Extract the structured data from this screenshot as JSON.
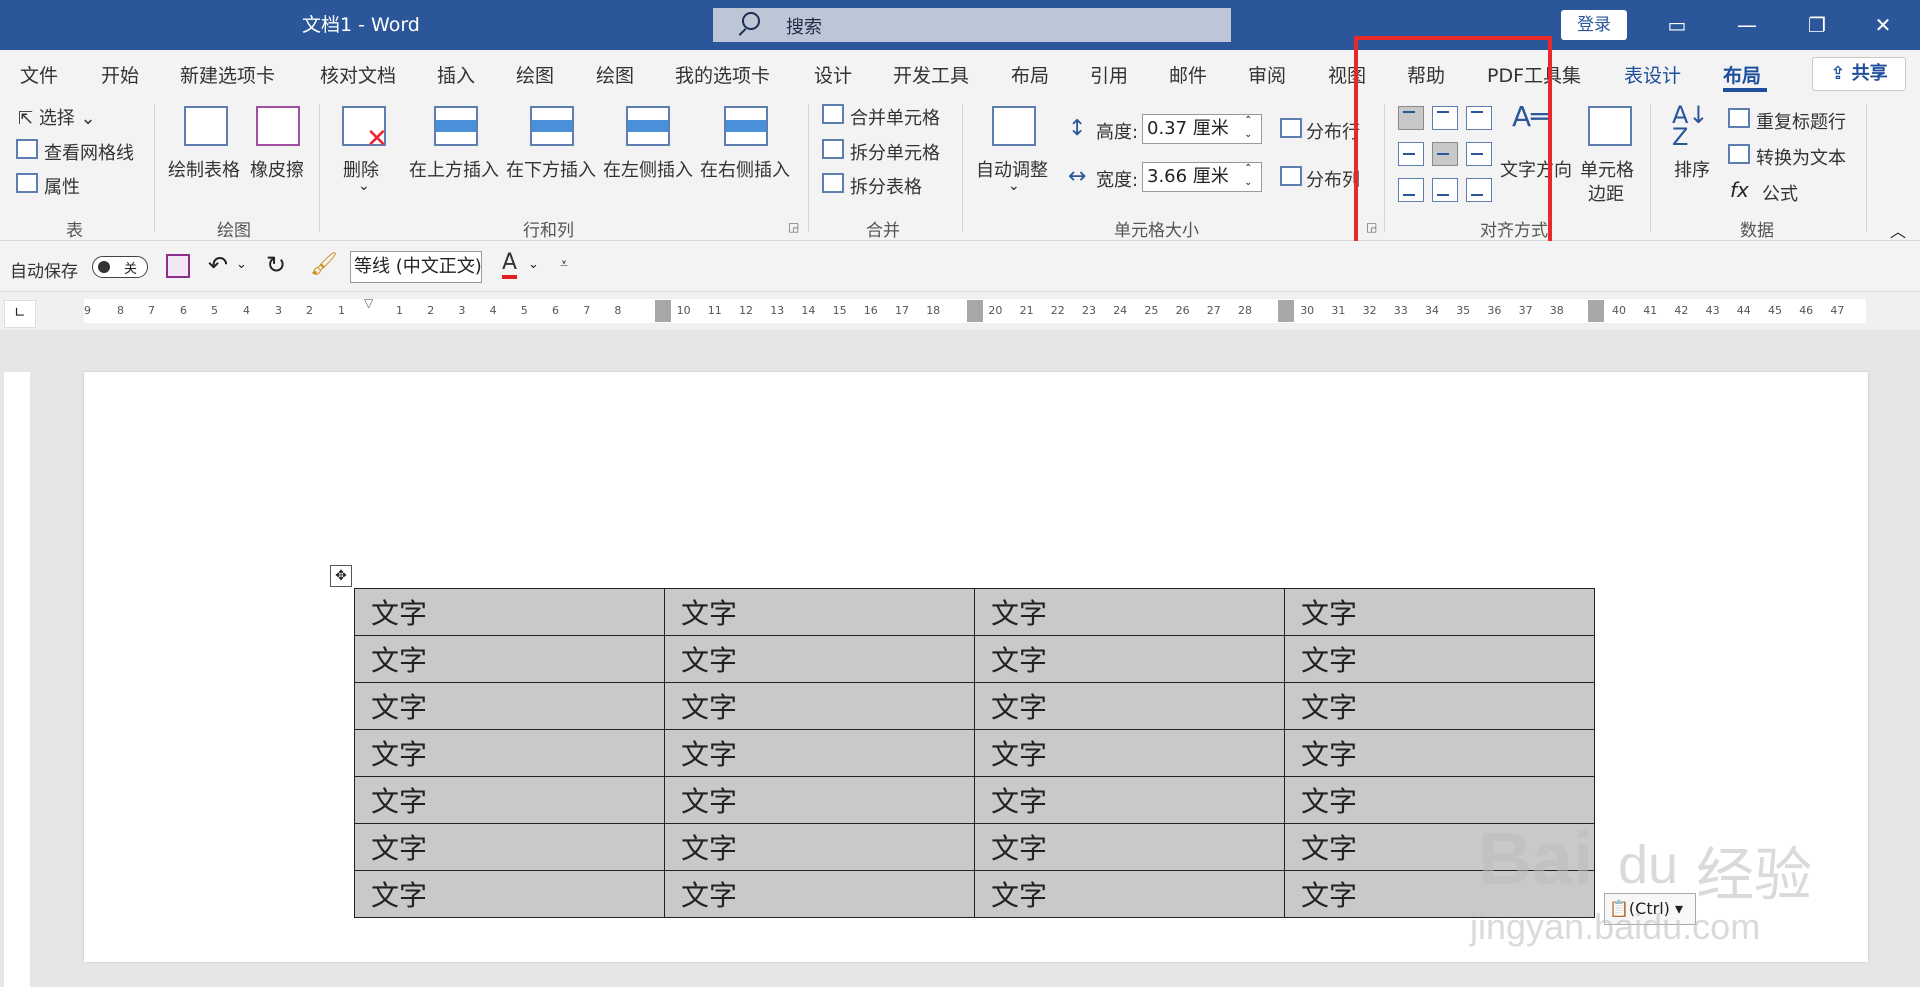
{
  "titlebar": {
    "doc_title": "文档1  -  Word",
    "search_label": "搜索",
    "login": "登录"
  },
  "tabs": [
    "文件",
    "开始",
    "新建选项卡",
    "核对文档",
    "插入",
    "绘图",
    "绘图",
    "我的选项卡",
    "设计",
    "开发工具",
    "布局",
    "引用",
    "邮件",
    "审阅",
    "视图",
    "帮助",
    "PDF工具集",
    "表设计",
    "布局"
  ],
  "share": "共享",
  "ribbon": {
    "table": {
      "select": "选择",
      "gridlines": "查看网格线",
      "properties": "属性",
      "group": "表"
    },
    "draw": {
      "draw_table": "绘制表格",
      "eraser": "橡皮擦",
      "group": "绘图"
    },
    "rows_cols": {
      "delete": "删除",
      "insert_above": "在上方插入",
      "insert_below": "在下方插入",
      "insert_left": "在左侧插入",
      "insert_right": "在右侧插入",
      "group": "行和列"
    },
    "merge": {
      "merge_cells": "合并单元格",
      "split_cells": "拆分单元格",
      "split_table": "拆分表格",
      "group": "合并"
    },
    "cell_size": {
      "autofit": "自动调整",
      "height_label": "高度:",
      "height_value": "0.37 厘米",
      "width_label": "宽度:",
      "width_value": "3.66 厘米",
      "distribute_rows": "分布行",
      "distribute_cols": "分布列",
      "group": "单元格大小"
    },
    "alignment": {
      "text_direction": "文字方向",
      "cell_margins_1": "单元格",
      "cell_margins_2": "边距",
      "group": "对齐方式"
    },
    "data": {
      "sort": "排序",
      "repeat_header": "重复标题行",
      "convert_text": "转换为文本",
      "formula": "公式",
      "group": "数据"
    }
  },
  "qat": {
    "autosave": "自动保存",
    "toggle_state": "关",
    "font": "等线 (中文正文)"
  },
  "ruler": {
    "left_nums": [
      "9",
      "8",
      "7",
      "6",
      "5",
      "4",
      "3",
      "2",
      "1"
    ],
    "nums": [
      "1",
      "2",
      "3",
      "4",
      "5",
      "6",
      "7",
      "8",
      "10",
      "11",
      "12",
      "13",
      "14",
      "15",
      "16",
      "17",
      "18",
      "20",
      "21",
      "22",
      "23",
      "24",
      "25",
      "26",
      "27",
      "28",
      "30",
      "31",
      "32",
      "33",
      "34",
      "35",
      "36",
      "37",
      "38",
      "40",
      "41",
      "42",
      "43",
      "44",
      "45",
      "46",
      "47"
    ]
  },
  "table_rows": [
    [
      "文字",
      "文字",
      "文字",
      "文字"
    ],
    [
      "文字",
      "文字",
      "文字",
      "文字"
    ],
    [
      "文字",
      "文字",
      "文字",
      "文字"
    ],
    [
      "文字",
      "文字",
      "文字",
      "文字"
    ],
    [
      "文字",
      "文字",
      "文字",
      "文字"
    ],
    [
      "文字",
      "文字",
      "文字",
      "文字"
    ],
    [
      "文字",
      "文字",
      "文字",
      "文字"
    ]
  ],
  "paste_options": "(Ctrl)",
  "watermark": {
    "brand": "Bai",
    "brand2": "du",
    "suffix": "经验",
    "url": "jingyan.baidu.com"
  },
  "colors": {
    "title_blue": "#2b579a",
    "highlight_red": "#e8282b",
    "cell_gray": "#c9c9c9"
  }
}
